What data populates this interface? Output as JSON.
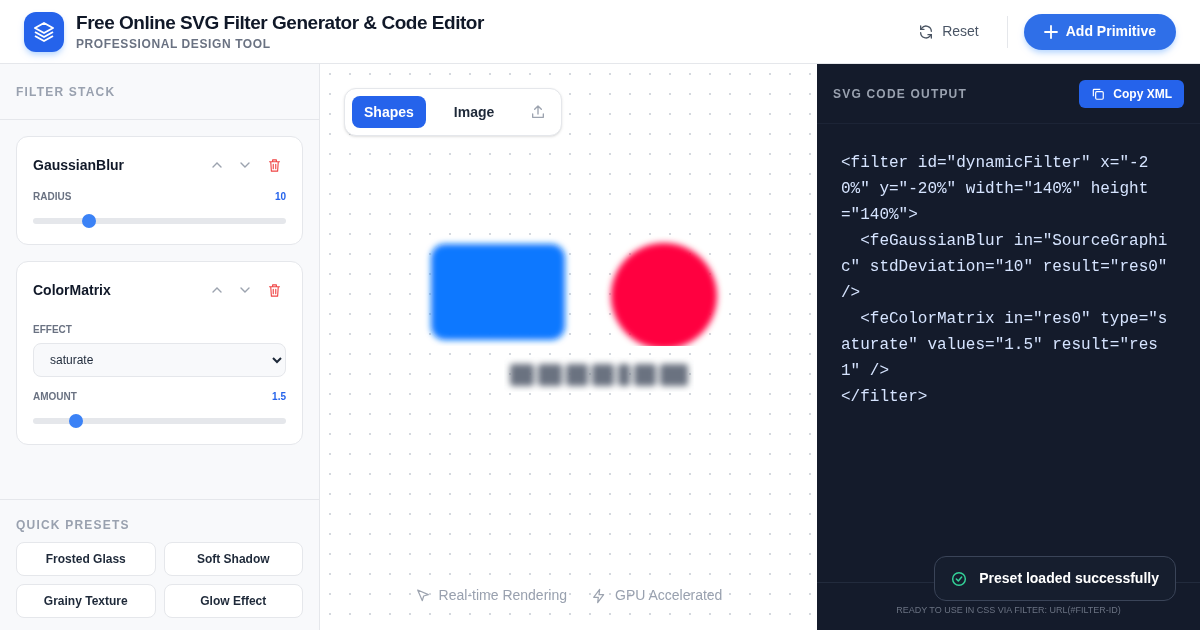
{
  "header": {
    "title": "Free Online SVG Filter Generator & Code Editor",
    "subtitle": "PROFESSIONAL DESIGN TOOL",
    "reset_button": "Reset",
    "add_button": "Add Primitive"
  },
  "filter_stack": {
    "heading": "FILTER STACK",
    "primitives": [
      {
        "name": "GaussianBlur",
        "controls": [
          {
            "kind": "slider",
            "label": "RADIUS",
            "reading": "10",
            "level": 0.22
          }
        ]
      },
      {
        "name": "ColorMatrix",
        "controls": [
          {
            "kind": "select",
            "label": "EFFECT",
            "value": "saturate"
          },
          {
            "kind": "slider",
            "label": "AMOUNT",
            "reading": "1.5",
            "level": 0.17
          }
        ]
      }
    ]
  },
  "quick_presets": {
    "heading": "QUICK PRESETS",
    "presets": [
      "Frosted Glass",
      "Soft Shadow",
      "Grainy Texture",
      "Glow Effect"
    ]
  },
  "preview": {
    "tabs": [
      {
        "label": "Shapes",
        "selected": true
      },
      {
        "label": "Image",
        "selected": false
      }
    ],
    "badges": [
      {
        "kind": "cursor",
        "label": "Real-time Rendering"
      },
      {
        "kind": "bolt",
        "label": "GPU Accelerated"
      }
    ]
  },
  "code_panel": {
    "heading": "SVG CODE OUTPUT",
    "copy_button": "Copy XML",
    "code_lines": [
      "<filter id=\"dynamicFilter\" x=\"-20%\" y=\"-20%\" width=\"140%\" height=\"140%\">",
      "  <feGaussianBlur in=\"SourceGraphic\" stdDeviation=\"10\" result=\"res0\" />",
      "  <feColorMatrix in=\"res0\" type=\"saturate\" values=\"1.5\" result=\"res1\" />",
      "</filter>"
    ],
    "footer": "READY TO USE IN CSS VIA FILTER: URL(#FILTER-ID)"
  },
  "toast": {
    "message": "Preset loaded successfully"
  }
}
